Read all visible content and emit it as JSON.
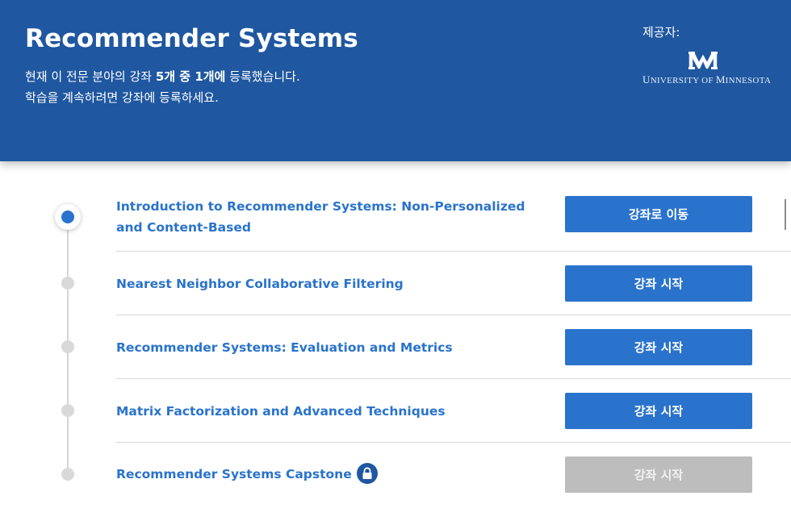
{
  "header": {
    "title": "Recommender Systems",
    "desc_prefix": "현재 이 전문 분야의 강좌 ",
    "desc_bold1": "5개 중 1개에",
    "desc_suffix": " 등록했습니다.",
    "desc_line2": "학습을 계속하려면 강좌에 등록하세요.",
    "provider_label": "제공자:",
    "provider_name_u": "U",
    "provider_name_rest1": "NIVERSITY OF ",
    "provider_name_m": "M",
    "provider_name_rest2": "INNESOTA"
  },
  "courses": [
    {
      "title": "Introduction to Recommender Systems: Non-Personalized and Content-Based",
      "button": "강좌로 이동",
      "locked": false
    },
    {
      "title": "Nearest Neighbor Collaborative Filtering",
      "button": "강좌 시작",
      "locked": false
    },
    {
      "title": "Recommender Systems: Evaluation and Metrics",
      "button": "강좌 시작",
      "locked": false
    },
    {
      "title": "Matrix Factorization and Advanced Techniques",
      "button": "강좌 시작",
      "locked": false
    },
    {
      "title": "Recommender Systems Capstone",
      "button": "강좌 시작",
      "locked": true
    }
  ],
  "colors": {
    "header_bg": "#1f57a0",
    "accent": "#2a73cc",
    "disabled": "#bdbdbd"
  },
  "icons": {
    "lock": "lock-icon",
    "logo": "university-logo-icon"
  }
}
